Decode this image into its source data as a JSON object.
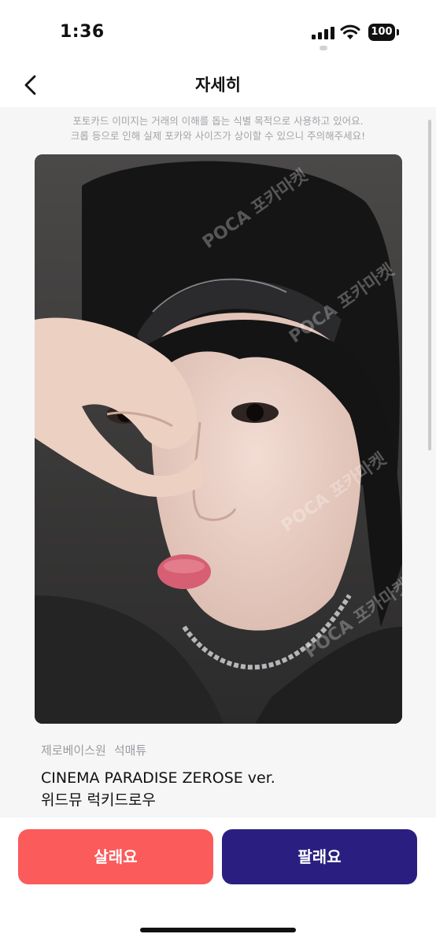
{
  "status_bar": {
    "time": "1:36",
    "battery": "100"
  },
  "nav": {
    "title": "자세히"
  },
  "notice": {
    "line1": "포토카드 이미지는 거래의 이해를 돕는 식별 목적으로 사용하고 있어요.",
    "line2": "크롭 등으로 인해 실제 포카와 사이즈가 상이할 수 있으니 주의해주세요!"
  },
  "photo": {
    "watermark_text": "POCA 포카마켓"
  },
  "item": {
    "group": "제로베이스원",
    "member": "석매튜",
    "album": "CINEMA PARADISE ZEROSE ver.",
    "version": "위드뮤 럭키드로우"
  },
  "actions": {
    "buy_label": "살래요",
    "sell_label": "팔래요"
  },
  "colors": {
    "buy": "#fb5b5b",
    "sell": "#2a1f80",
    "notice_text": "#a4a4a8"
  }
}
